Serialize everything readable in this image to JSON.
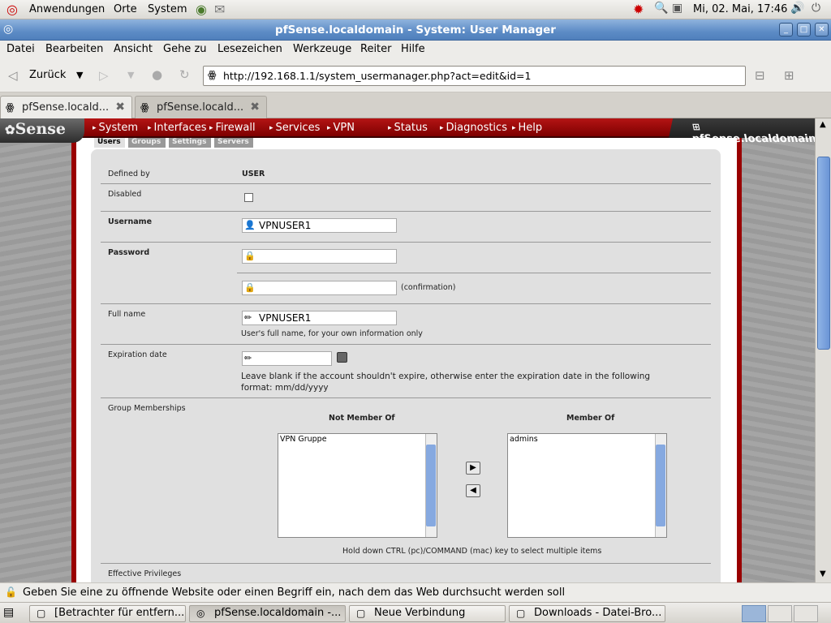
{
  "panel": {
    "apps": "Anwendungen",
    "places": "Orte",
    "system": "System",
    "clock": "Mi, 02. Mai, 17:46"
  },
  "window": {
    "title": "pfSense.localdomain - System: User Manager"
  },
  "menubar": [
    "Datei",
    "Bearbeiten",
    "Ansicht",
    "Gehe zu",
    "Lesezeichen",
    "Werkzeuge",
    "Reiter",
    "Hilfe"
  ],
  "nav": {
    "back": "Zurück",
    "url": "http://192.168.1.1/system_usermanager.php?act=edit&id=1"
  },
  "tabs": [
    {
      "label": "pfSense.locald..."
    },
    {
      "label": "pfSense.locald..."
    }
  ],
  "site": {
    "logo": "Sense",
    "menu": [
      "System",
      "Interfaces",
      "Firewall",
      "Services",
      "VPN",
      "Status",
      "Diagnostics",
      "Help"
    ],
    "hostname": "pfSense.localdomain",
    "subtabs": [
      "Users",
      "Groups",
      "Settings",
      "Servers"
    ]
  },
  "form": {
    "defined_by_label": "Defined by",
    "defined_by_value": "USER",
    "disabled_label": "Disabled",
    "username_label": "Username",
    "username_value": "VPNUSER1",
    "password_label": "Password",
    "confirmation": "(confirmation)",
    "fullname_label": "Full name",
    "fullname_value": "VPNUSER1",
    "fullname_note": "User's full name, for your own information only",
    "expiration_label": "Expiration date",
    "expiration_note_1": "Leave blank if the account shouldn't expire, otherwise enter the expiration date in the following",
    "expiration_note_2": "format: mm/dd/yyyy",
    "groups_label": "Group Memberships",
    "not_member_header": "Not Member Of",
    "member_header": "Member Of",
    "not_member_items": [
      "VPN Gruppe"
    ],
    "member_items": [
      "admins"
    ],
    "multi_select_note": "Hold down CTRL (pc)/COMMAND (mac) key to select multiple items",
    "privileges_label": "Effective Privileges"
  },
  "statusbar": "Geben Sie eine zu öffnende Website oder einen Begriff ein, nach dem das Web durchsucht werden soll",
  "taskbar": [
    {
      "label": "[Betrachter für entfern...",
      "active": false
    },
    {
      "label": "pfSense.localdomain -...",
      "active": true
    },
    {
      "label": "Neue Verbindung",
      "active": false
    },
    {
      "label": "Downloads - Datei-Bro...",
      "active": false
    }
  ]
}
